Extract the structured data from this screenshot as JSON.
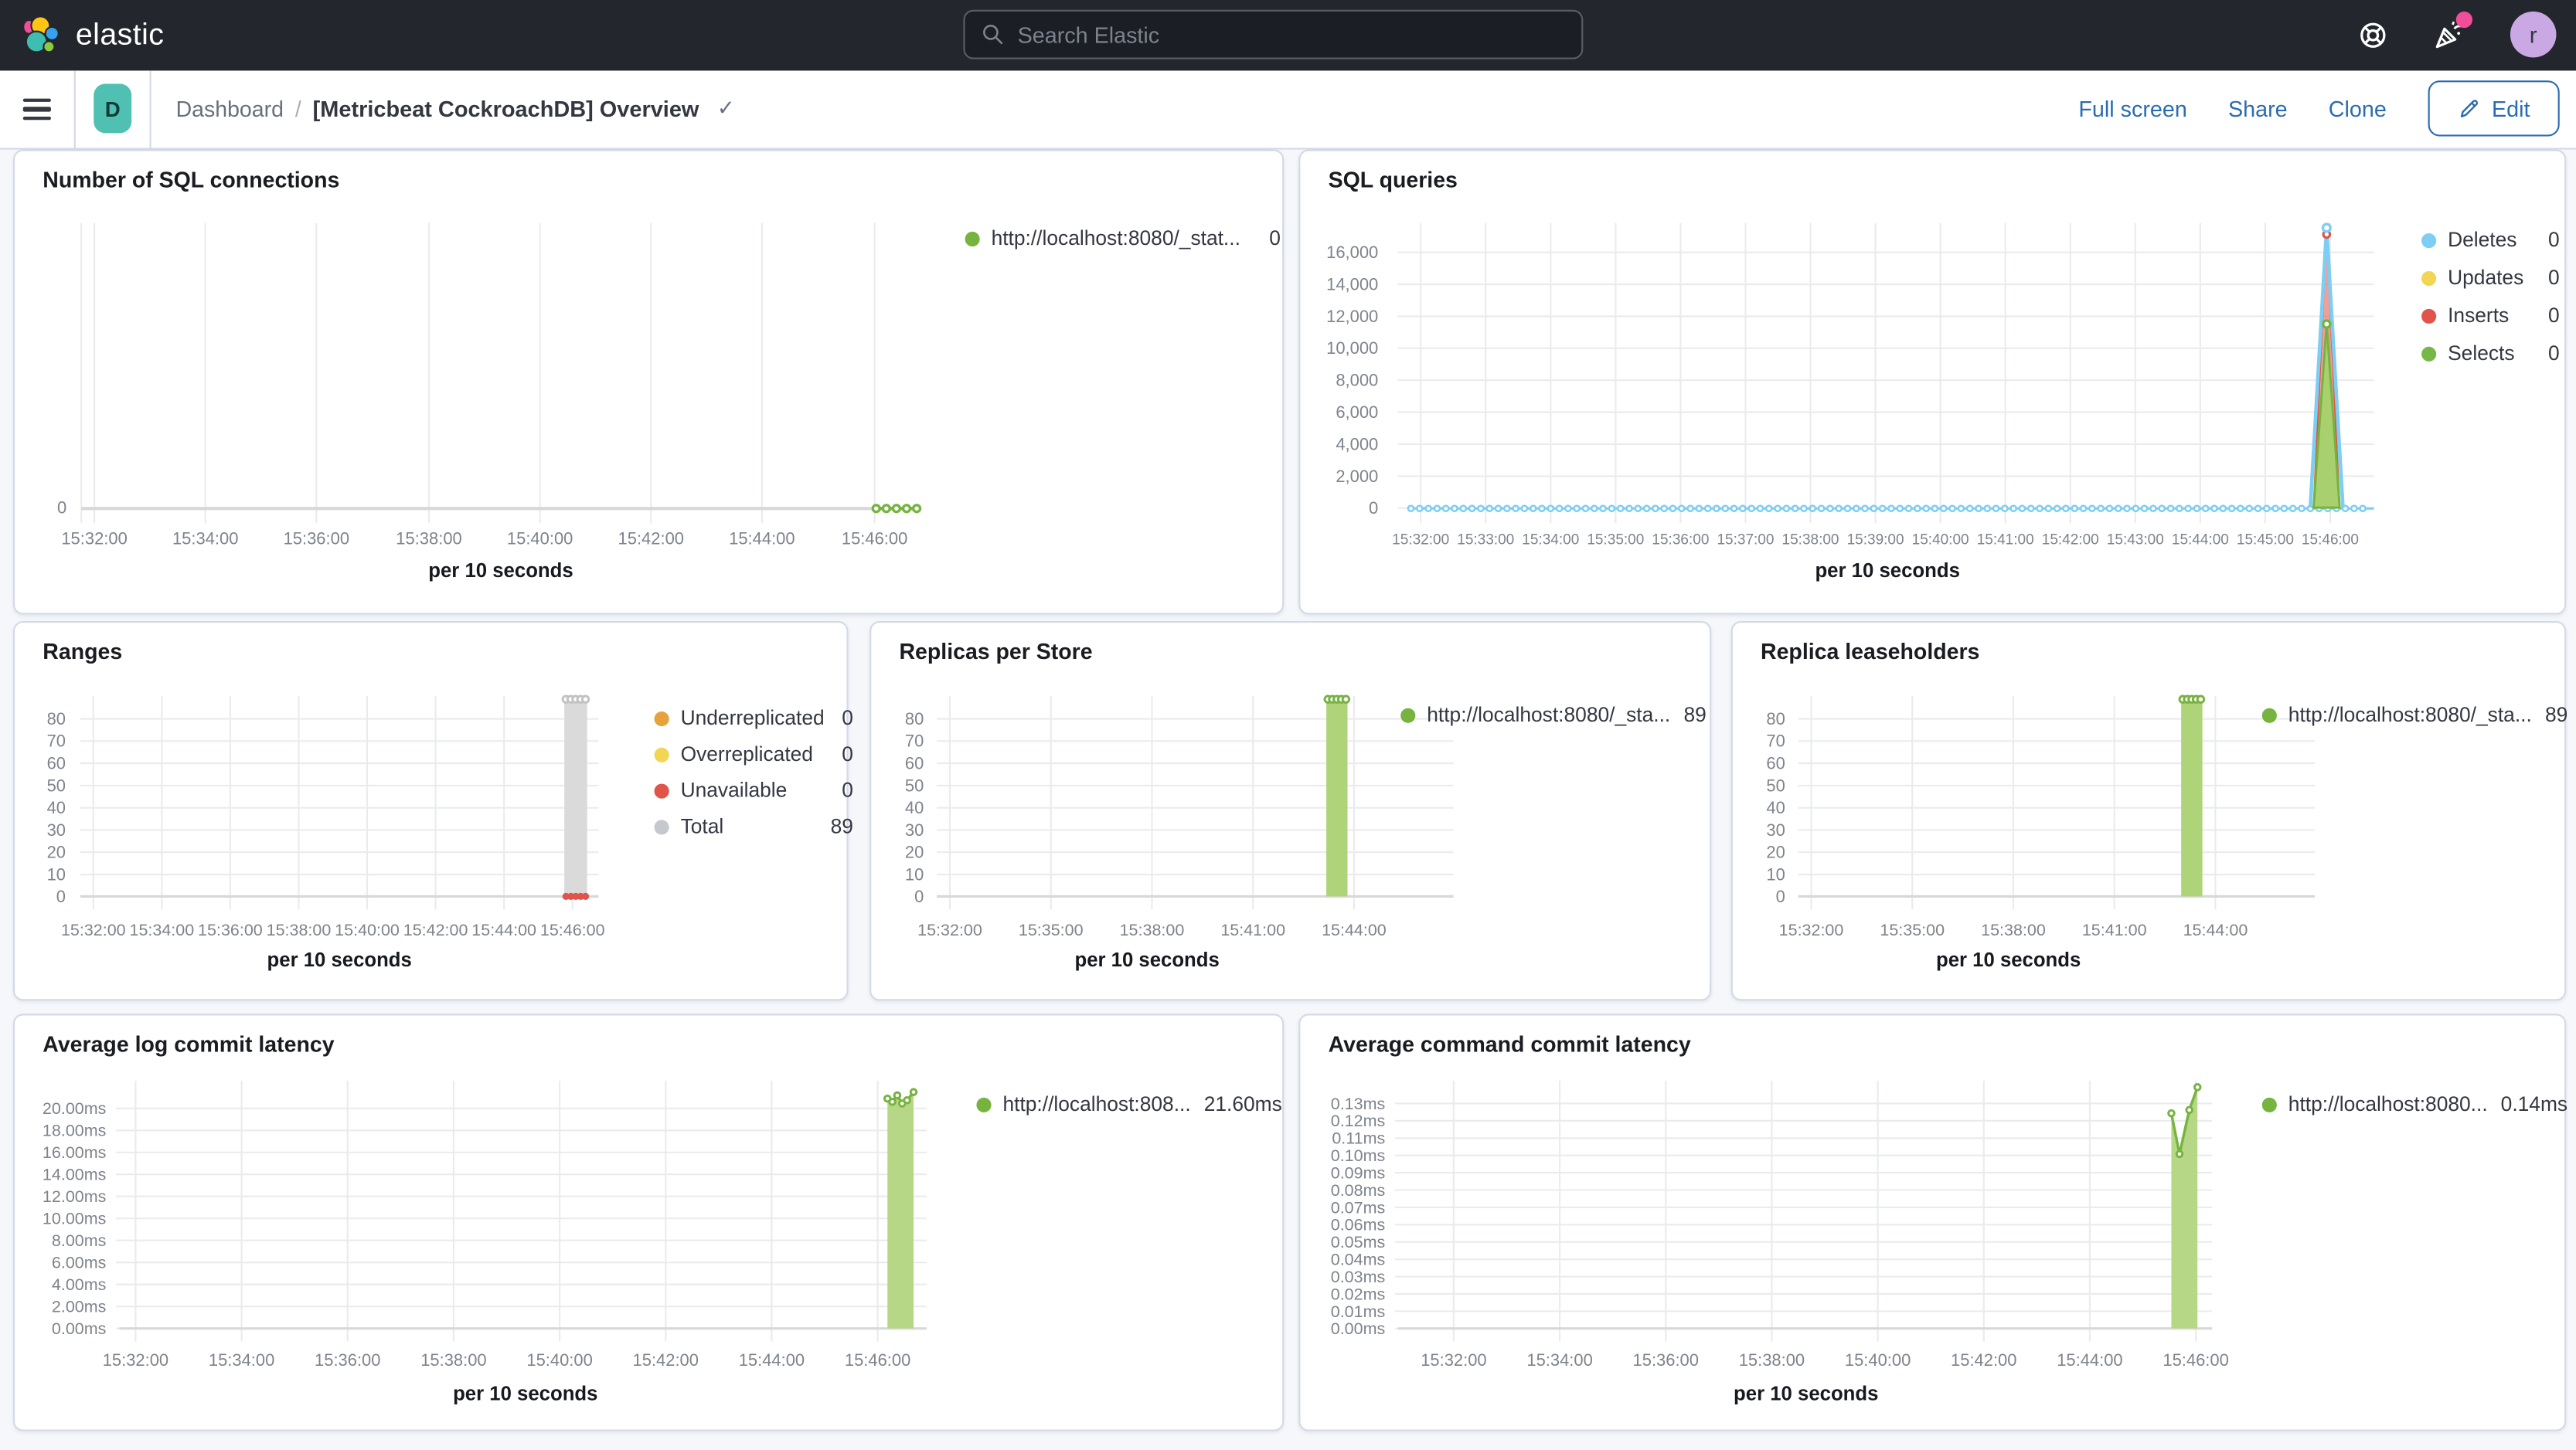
{
  "topbar": {
    "brand": "elastic",
    "search_placeholder": "Search Elastic",
    "avatar_initial": "r",
    "icons": {
      "help": "help-icon",
      "news": "newsfeed-icon",
      "search": "search-icon"
    },
    "badge_color": "#f04e98"
  },
  "toolbar": {
    "space_badge": "D",
    "breadcrumb_root": "Dashboard",
    "breadcrumb_sep": "/",
    "title": "[Metricbeat CockroachDB] Overview",
    "check": "✓",
    "actions": [
      "Full screen",
      "Share",
      "Clone"
    ],
    "edit_label": "Edit",
    "accent_color": "#2a6cb2"
  },
  "chart_data": [
    {
      "id": "sql-connections",
      "type": "line",
      "title": "Number of SQL connections",
      "xlabel": "per 10 seconds",
      "x_ticks": [
        "15:32:00",
        "15:34:00",
        "15:36:00",
        "15:38:00",
        "15:40:00",
        "15:42:00",
        "15:44:00",
        "15:46:00"
      ],
      "y_ticks": [
        "0"
      ],
      "ylim": [
        0,
        1
      ],
      "legend": [
        {
          "label": "http://localhost:8080/_stat...",
          "value": "0",
          "color": "#77b33f"
        }
      ],
      "series": [
        {
          "name": "http://localhost:8080/_stat...",
          "color": "#77b33f",
          "current": 0,
          "times": [
            "15:45:30",
            "15:45:40",
            "15:45:50",
            "15:46:00",
            "15:46:10"
          ],
          "values": [
            0,
            0,
            0,
            0,
            0
          ]
        }
      ]
    },
    {
      "id": "sql-queries",
      "type": "area",
      "title": "SQL queries",
      "xlabel": "per 10 seconds",
      "x_ticks": [
        "15:32:00",
        "15:33:00",
        "15:34:00",
        "15:35:00",
        "15:36:00",
        "15:37:00",
        "15:38:00",
        "15:39:00",
        "15:40:00",
        "15:41:00",
        "15:42:00",
        "15:43:00",
        "15:44:00",
        "15:45:00",
        "15:46:00"
      ],
      "y_ticks": [
        "16,000",
        "14,000",
        "12,000",
        "10,000",
        "8,000",
        "6,000",
        "4,000",
        "2,000",
        "0"
      ],
      "ylim": [
        0,
        17500
      ],
      "legend": [
        {
          "label": "Deletes",
          "value": "0",
          "color": "#7ecdf2"
        },
        {
          "label": "Updates",
          "value": "0",
          "color": "#f1d553"
        },
        {
          "label": "Inserts",
          "value": "0",
          "color": "#e0544a"
        },
        {
          "label": "Selects",
          "value": "0",
          "color": "#77b748"
        }
      ],
      "series": [
        {
          "name": "Deletes",
          "color": "#7ecdf2",
          "current": 0,
          "baseline": 0,
          "peak_value": 17500,
          "peak_time": "15:45:50"
        },
        {
          "name": "Updates",
          "color": "#f1d553",
          "current": 0,
          "baseline": 0,
          "peak_value": 0,
          "peak_time": "15:45:50"
        },
        {
          "name": "Inserts",
          "color": "#e0544a",
          "current": 0,
          "baseline": 0,
          "peak_value": 17200,
          "peak_time": "15:45:50"
        },
        {
          "name": "Selects",
          "color": "#77b748",
          "current": 0,
          "baseline": 0,
          "peak_value": 11500,
          "peak_time": "15:45:50"
        }
      ]
    },
    {
      "id": "ranges",
      "type": "bar",
      "title": "Ranges",
      "xlabel": "per 10 seconds",
      "x_ticks": [
        "15:32:00",
        "15:34:00",
        "15:36:00",
        "15:38:00",
        "15:40:00",
        "15:42:00",
        "15:44:00",
        "15:46:00"
      ],
      "y_ticks": [
        "80",
        "70",
        "60",
        "50",
        "40",
        "30",
        "20",
        "10",
        "0"
      ],
      "ylim": [
        0,
        89
      ],
      "legend": [
        {
          "label": "Underreplicated",
          "value": "0",
          "color": "#e8a23c"
        },
        {
          "label": "Overreplicated",
          "value": "0",
          "color": "#f1d553"
        },
        {
          "label": "Unavailable",
          "value": "0",
          "color": "#e0544a"
        },
        {
          "label": "Total",
          "value": "89",
          "color": "#c5c8cd"
        }
      ],
      "series": [
        {
          "name": "Underreplicated",
          "current": 0,
          "values": [
            0,
            0,
            0,
            0,
            0
          ]
        },
        {
          "name": "Overreplicated",
          "current": 0,
          "values": [
            0,
            0,
            0,
            0,
            0
          ]
        },
        {
          "name": "Unavailable",
          "current": 0,
          "values": [
            0,
            0,
            0,
            0,
            0
          ]
        },
        {
          "name": "Total",
          "current": 89,
          "bar": {
            "start": "15:45:30",
            "end": "15:46:10",
            "value": 89
          }
        }
      ]
    },
    {
      "id": "replicas-per-store",
      "type": "bar",
      "title": "Replicas per Store",
      "xlabel": "per 10 seconds",
      "x_ticks": [
        "15:32:00",
        "15:35:00",
        "15:38:00",
        "15:41:00",
        "15:44:00"
      ],
      "y_ticks": [
        "80",
        "70",
        "60",
        "50",
        "40",
        "30",
        "20",
        "10",
        "0"
      ],
      "ylim": [
        0,
        89
      ],
      "legend": [
        {
          "label": "http://localhost:8080/_sta...",
          "value": "89",
          "color": "#77b33f"
        }
      ],
      "series": [
        {
          "name": "http://localhost:8080/_sta...",
          "current": 89,
          "bar": {
            "start": "15:45:30",
            "end": "15:46:10",
            "value": 89
          }
        }
      ]
    },
    {
      "id": "replica-leaseholders",
      "type": "bar",
      "title": "Replica leaseholders",
      "xlabel": "per 10 seconds",
      "x_ticks": [
        "15:32:00",
        "15:35:00",
        "15:38:00",
        "15:41:00",
        "15:44:00"
      ],
      "y_ticks": [
        "80",
        "70",
        "60",
        "50",
        "40",
        "30",
        "20",
        "10",
        "0"
      ],
      "ylim": [
        0,
        89
      ],
      "legend": [
        {
          "label": "http://localhost:8080/_sta...",
          "value": "89",
          "color": "#77b33f"
        }
      ],
      "series": [
        {
          "name": "http://localhost:8080/_sta...",
          "current": 89,
          "bar": {
            "start": "15:45:30",
            "end": "15:46:10",
            "value": 89
          }
        }
      ]
    },
    {
      "id": "avg-log-commit-latency",
      "type": "area",
      "title": "Average log commit latency",
      "xlabel": "per 10 seconds",
      "x_ticks": [
        "15:32:00",
        "15:34:00",
        "15:36:00",
        "15:38:00",
        "15:40:00",
        "15:42:00",
        "15:44:00",
        "15:46:00"
      ],
      "y_ticks": [
        "20.00ms",
        "18.00ms",
        "16.00ms",
        "14.00ms",
        "12.00ms",
        "10.00ms",
        "8.00ms",
        "6.00ms",
        "4.00ms",
        "2.00ms",
        "0.00ms"
      ],
      "ylim": [
        0,
        22
      ],
      "legend": [
        {
          "label": "http://localhost:808...",
          "value": "21.60ms",
          "color": "#77b33f"
        }
      ],
      "series": [
        {
          "name": "http://localhost:808...",
          "current": "21.60ms",
          "times": [
            "15:45:10",
            "15:45:20",
            "15:45:30",
            "15:45:40",
            "15:45:50",
            "15:46:00"
          ],
          "values_ms": [
            21.1,
            20.9,
            21.5,
            20.8,
            21.0,
            21.6
          ]
        }
      ]
    },
    {
      "id": "avg-command-commit-latency",
      "type": "area",
      "title": "Average command commit latency",
      "xlabel": "per 10 seconds",
      "x_ticks": [
        "15:32:00",
        "15:34:00",
        "15:36:00",
        "15:38:00",
        "15:40:00",
        "15:42:00",
        "15:44:00",
        "15:46:00"
      ],
      "y_ticks": [
        "0.13ms",
        "0.12ms",
        "0.11ms",
        "0.10ms",
        "0.09ms",
        "0.08ms",
        "0.07ms",
        "0.06ms",
        "0.05ms",
        "0.04ms",
        "0.03ms",
        "0.02ms",
        "0.01ms",
        "0.00ms"
      ],
      "ylim": [
        0,
        0.145
      ],
      "legend": [
        {
          "label": "http://localhost:8080...",
          "value": "0.14ms",
          "color": "#77b33f"
        }
      ],
      "series": [
        {
          "name": "http://localhost:8080...",
          "current": "0.14ms",
          "times": [
            "15:45:30",
            "15:45:40",
            "15:45:50",
            "15:46:00"
          ],
          "values_ms": [
            0.129,
            0.105,
            0.131,
            0.14
          ]
        }
      ]
    }
  ]
}
